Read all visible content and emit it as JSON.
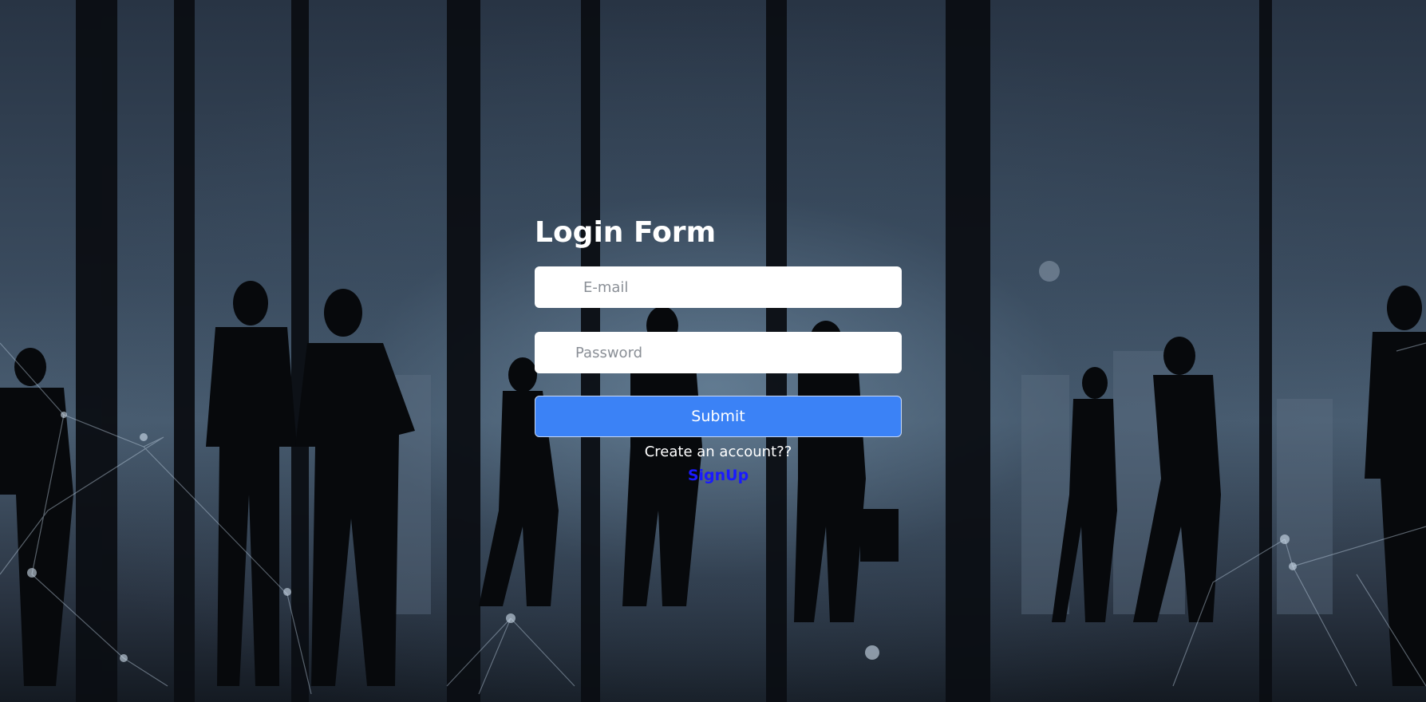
{
  "page": {
    "background_description_icon": "office-silhouettes-background"
  },
  "form": {
    "title": "Login Form",
    "email_placeholder": "E-mail",
    "email_value": "",
    "password_placeholder": "Password",
    "password_value": "",
    "submit_label": "Submit",
    "create_account_text": "Create an account??",
    "signup_link": "SignUp"
  },
  "colors": {
    "submit_bg": "#3b82f6",
    "signup_link": "#1a1aff",
    "title": "#ffffff"
  }
}
